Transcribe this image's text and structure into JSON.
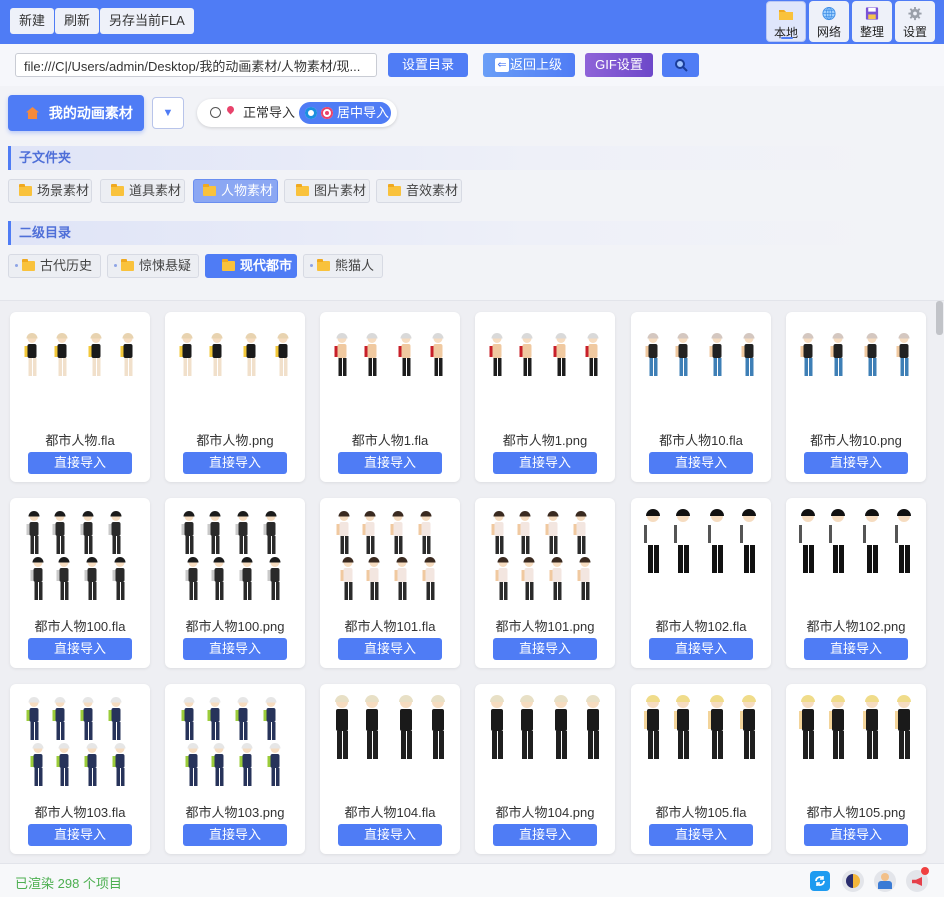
{
  "toolbar": {
    "new_label": "新建",
    "refresh_label": "刷新",
    "saveas_label": "另存当前FLA"
  },
  "tabs": [
    {
      "label": "本地",
      "icon": "folder-icon",
      "active": true
    },
    {
      "label": "网络",
      "icon": "globe-icon",
      "active": false
    },
    {
      "label": "整理",
      "icon": "save-icon",
      "active": false
    },
    {
      "label": "设置",
      "icon": "gear-icon",
      "active": false
    }
  ],
  "path": {
    "value": "file:///C|/Users/admin/Desktop/我的动画素材/人物素材/现...",
    "set_dir_label": "设置目录",
    "back_label": "返回上级",
    "gif_label": "GIF设置",
    "search_icon": "search-icon"
  },
  "home": {
    "label": "我的动画素材",
    "dropdown_glyph": "▼"
  },
  "import_mode": {
    "normal_label": "正常导入",
    "center_label": "居中导入",
    "selected": "center"
  },
  "subfolders": {
    "title": "子文件夹",
    "items": [
      "场景素材",
      "道具素材",
      "人物素材",
      "图片素材",
      "音效素材"
    ],
    "active_index": 2
  },
  "level2": {
    "title": "二级目录",
    "items": [
      "古代历史",
      "惊悚悬疑",
      "现代都市",
      "熊猫人"
    ],
    "active_index": 2
  },
  "grid": {
    "import_label": "直接导入",
    "items": [
      {
        "name": "都市人物.fla",
        "style": "girl"
      },
      {
        "name": "都市人物.png",
        "style": "girl"
      },
      {
        "name": "都市人物1.fla",
        "style": "shirtless"
      },
      {
        "name": "都市人物1.png",
        "style": "shirtless"
      },
      {
        "name": "都市人物10.fla",
        "style": "jeans"
      },
      {
        "name": "都市人物10.png",
        "style": "jeans"
      },
      {
        "name": "都市人物100.fla",
        "style": "darksuit"
      },
      {
        "name": "都市人物100.png",
        "style": "darksuit"
      },
      {
        "name": "都市人物101.fla",
        "style": "small"
      },
      {
        "name": "都市人物101.png",
        "style": "small"
      },
      {
        "name": "都市人物102.fla",
        "style": "afro"
      },
      {
        "name": "都市人物102.png",
        "style": "afro"
      },
      {
        "name": "都市人物103.fla",
        "style": "police"
      },
      {
        "name": "都市人物103.png",
        "style": "police"
      },
      {
        "name": "都市人物104.fla",
        "style": "vest"
      },
      {
        "name": "都市人物104.png",
        "style": "vest"
      },
      {
        "name": "都市人物105.fla",
        "style": "blonde"
      },
      {
        "name": "都市人物105.png",
        "style": "blonde"
      }
    ]
  },
  "status": {
    "text": "已渲染 298 个项目"
  },
  "status_icons": [
    "sync-icon",
    "theme-icon",
    "user-icon",
    "notify-icon"
  ],
  "colors": {
    "accent": "#4f7cf5",
    "status_green": "#4caf50",
    "gif_purple": "#7a52d6"
  }
}
